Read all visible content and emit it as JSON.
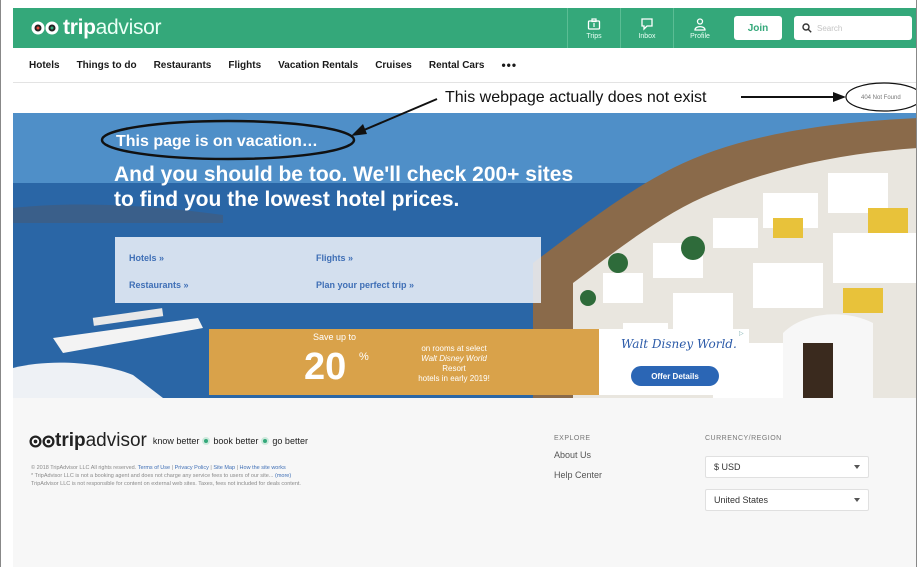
{
  "header": {
    "logo_trip": "trip",
    "logo_advisor": "advisor",
    "icons": [
      {
        "label": "Trips",
        "icon": "briefcase-icon"
      },
      {
        "label": "Inbox",
        "icon": "message-icon"
      },
      {
        "label": "Profile",
        "icon": "person-icon"
      }
    ],
    "join_label": "Join",
    "search_placeholder": "Search",
    "brand_color": "#34a87a"
  },
  "subnav": {
    "items": [
      "Hotels",
      "Things to do",
      "Restaurants",
      "Flights",
      "Vacation Rentals",
      "Cruises",
      "Rental Cars"
    ],
    "more": "•••"
  },
  "annotation": {
    "text": "This webpage actually does not exist",
    "badge": "404 Not Found"
  },
  "hero": {
    "small_text": "This page is on vacation…",
    "title": "And you should be too. We'll check 200+ sites to find you the lowest hotel prices.",
    "links": [
      "Hotels »",
      "Flights »",
      "Restaurants »",
      "Plan your perfect trip »"
    ]
  },
  "ad": {
    "save": "Save up to",
    "percent": "20",
    "percent_sign": "%",
    "desc_1": "on rooms at select",
    "desc_2": "Walt Disney World",
    "desc_3": "Resort",
    "desc_4": "hotels in early 2019!",
    "brand": "Walt Disney World.",
    "offer": "Offer Details",
    "badge": "▷"
  },
  "footer": {
    "logo_trip": "trip",
    "logo_advisor": "advisor",
    "tag_1": "know better",
    "tag_2": "book better",
    "tag_3": "go better",
    "fine_1": "© 2018 TripAdvisor LLC All rights reserved.",
    "fine_terms": "Terms of Use",
    "fine_privacy": "Privacy Policy",
    "fine_sitemap": "Site Map",
    "fine_how": "How the site works",
    "fine_2": "* TripAdvisor LLC is not a booking agent and does not charge any service fees to users of our site... ",
    "fine_more": "(more)",
    "fine_3": "TripAdvisor LLC is not responsible for content on external web sites. Taxes, fees not included for deals content.",
    "explore_heading": "EXPLORE",
    "explore_links": [
      "About Us",
      "Help Center"
    ],
    "currency_heading": "CURRENCY/REGION",
    "currency_value": "$ USD",
    "region_value": "United States"
  }
}
